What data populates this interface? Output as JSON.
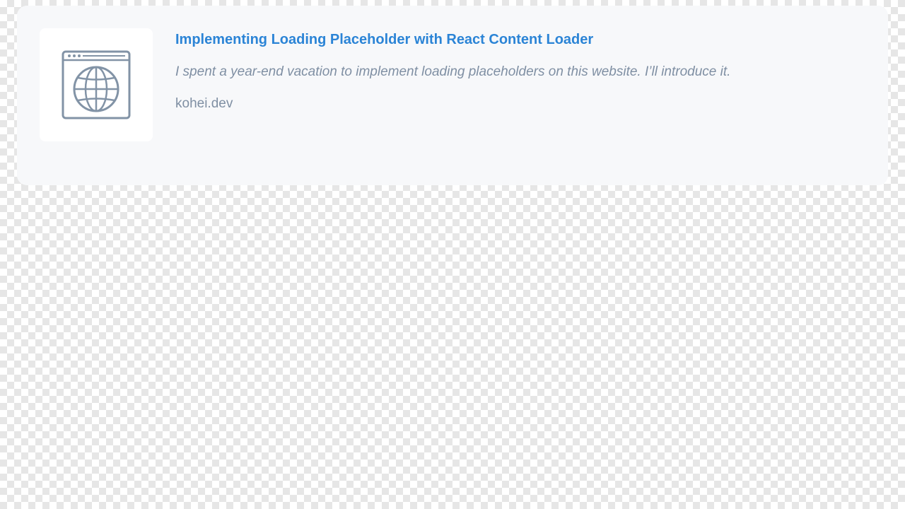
{
  "card": {
    "title": "Implementing Loading Placeholder with React Content Loader",
    "description": "I spent a year-end vacation to implement loading placeholders on this website. I’ll introduce it.",
    "domain": "kohei.dev",
    "thumbnail_icon": "browser-globe-icon"
  },
  "colors": {
    "title": "#2b84d6",
    "text_muted": "#7f8fa3",
    "icon": "#8293a6",
    "card_background": "#f7f8fa"
  }
}
